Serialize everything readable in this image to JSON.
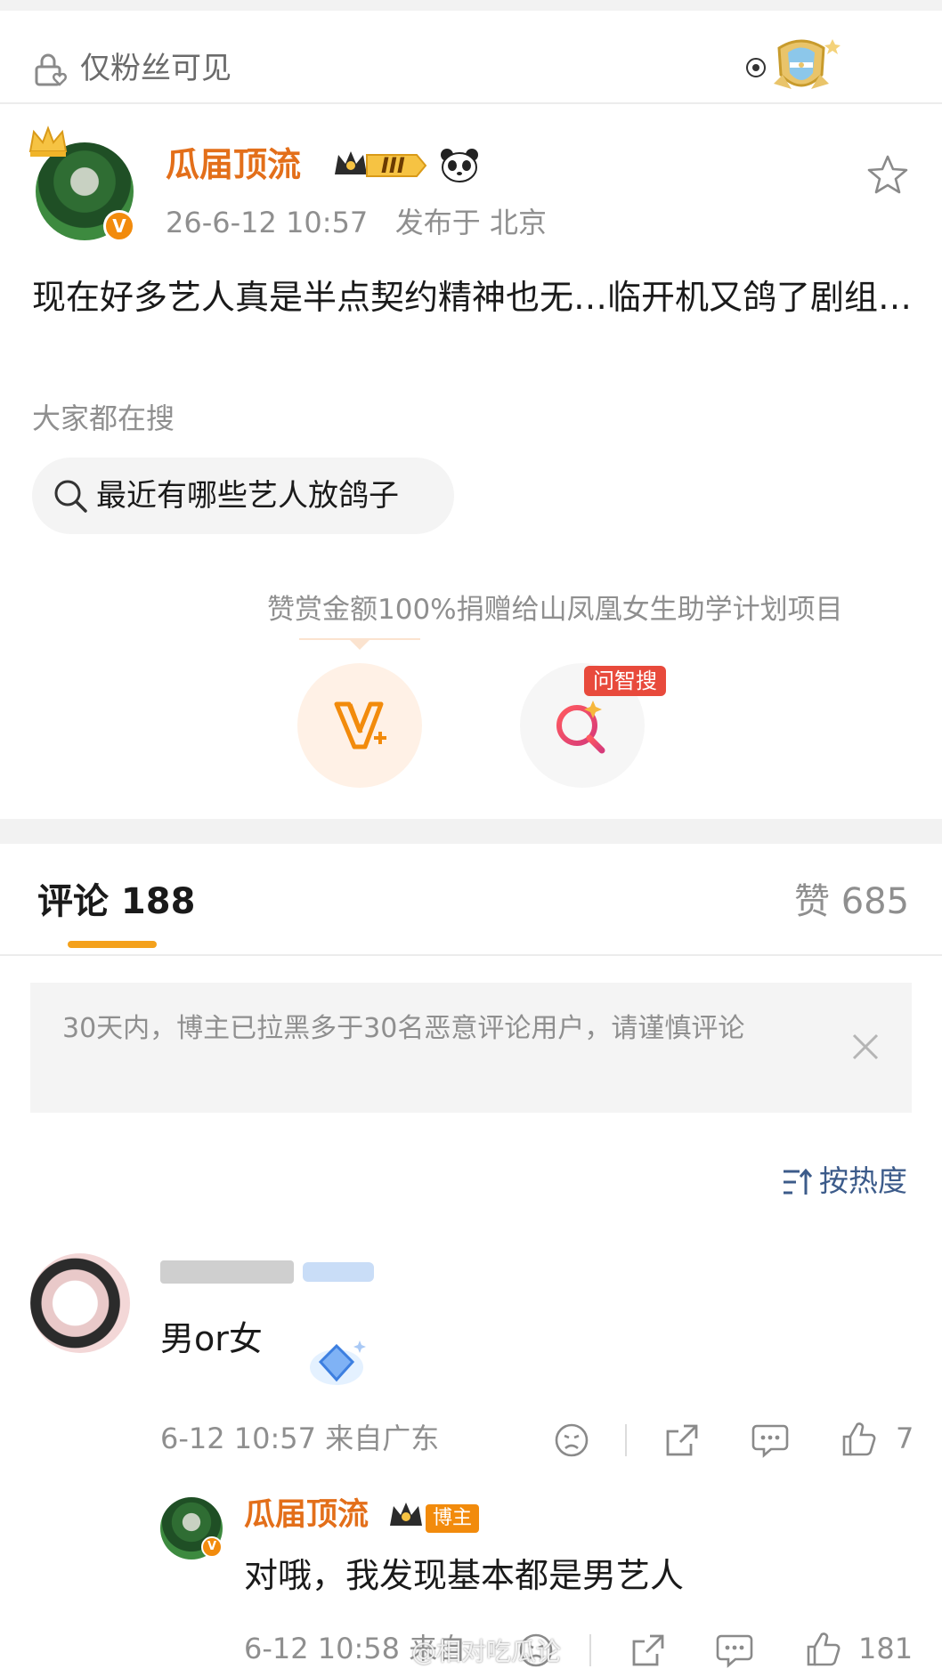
{
  "privacy": {
    "label": "仅粉丝可见"
  },
  "post": {
    "author": "瓜届顶流",
    "level_badge": "III",
    "verified_badge": "V",
    "meta": "26-6-12 10:57   发布于 北京",
    "body": "现在好多艺人真是半点契约精神也无…临开机又鸽了剧组…",
    "search_hint": "大家都在搜",
    "search_pill": "最近有哪些艺人放鸽子",
    "reward_text": "赞赏金额100%捐赠给山凤凰女生助学计划项目",
    "ai_tag": "问智搜"
  },
  "tabs": {
    "comments_label": "评论 188",
    "likes_label": "赞 685"
  },
  "notice": {
    "text": "30天内，博主已拉黑多于30名恶意评论用户，请谨慎评论"
  },
  "sort": {
    "label": "按热度"
  },
  "comment": {
    "text": "男or女",
    "meta": "6-12 10:57 来自广东",
    "like_count": "7"
  },
  "reply": {
    "author": "瓜届顶流",
    "tag": "博主",
    "text": "对哦，我发现基本都是男艺人",
    "meta": "6-12 10:58 来自",
    "like_count": "181",
    "watermark": "@相对吃瓜论"
  },
  "colors": {
    "accent_orange": "#e36f1a",
    "tab_indicator": "#f4a11c",
    "link_blue": "#3c5b8a",
    "ai_tag_red": "#e84a3c"
  }
}
